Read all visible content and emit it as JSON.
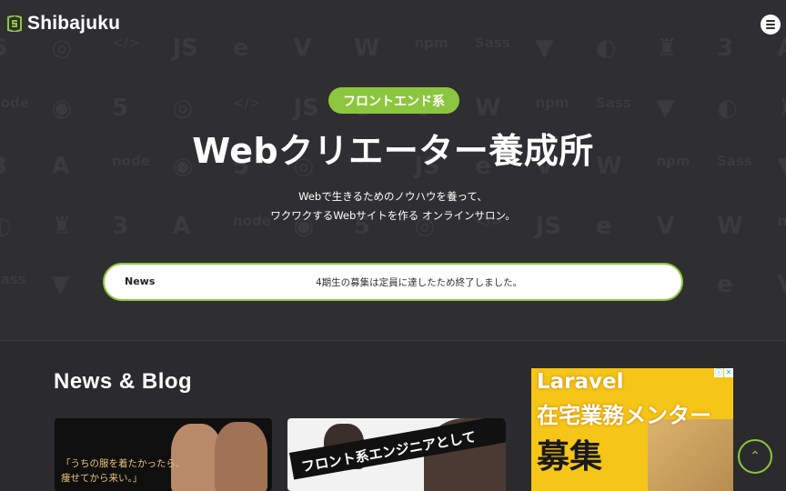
{
  "header": {
    "logo_text": "Shibajuku",
    "menu_icon": "hamburger-menu-icon"
  },
  "hero": {
    "badge": "フロントエンド系",
    "title": "Webクリエーター養成所",
    "subtitle_line1": "Webで生きるためのノウハウを養って、",
    "subtitle_line2": "ワクワクするWebサイトを作る オンラインサロン。",
    "background_icons": [
      "html5-icon",
      "safari-icon",
      "code-icon",
      "js-icon",
      "edge-icon",
      "vue-icon",
      "wordpress-icon",
      "npm-icon",
      "sass-icon",
      "gulp-icon",
      "firefox-icon",
      "castle-icon",
      "css3-icon",
      "angular-icon",
      "node-icon",
      "chrome-icon"
    ]
  },
  "news": {
    "label": "News",
    "text": "4期生の募集は定員に達したため終了しました。"
  },
  "section": {
    "title": "News & Blog"
  },
  "cards": [
    {
      "caption_line1": "「うちの服を着たかったら、",
      "caption_line2": "痩せてから来い。」"
    },
    {
      "caption": "フロント系エンジニアとして"
    }
  ],
  "ad": {
    "line1": "Laravel",
    "line2": "在宅業務メンター",
    "line3": "募集",
    "info_icon": "ad-info-icon",
    "close_icon": "ad-close-icon"
  },
  "scroll_top": {
    "icon": "chevron-up-icon",
    "glyph": "⌃"
  },
  "colors": {
    "accent": "#8cc63f",
    "background": "#2f2f31",
    "ad": "#f5c518"
  }
}
